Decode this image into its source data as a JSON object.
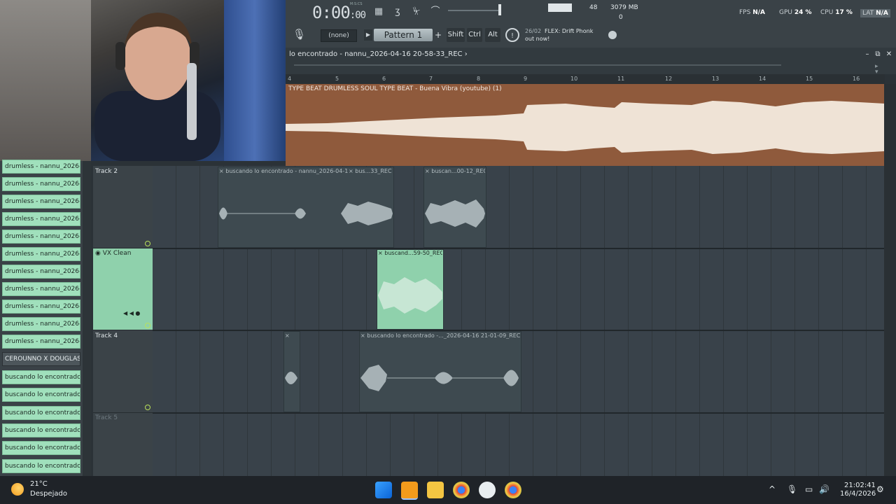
{
  "transport": {
    "time": "0:00",
    "time_frac": ":00",
    "time_sub": "M:S:CS"
  },
  "stats": {
    "cpu_graph_num": "48",
    "memory": "3079 MB",
    "polyphony": "0"
  },
  "perf": {
    "fps_label": "FPS",
    "fps_value": "N/A",
    "gpu_label": "GPU",
    "gpu_value": "24 %",
    "cpu_label": "CPU",
    "cpu_value": "17 %",
    "lat_label": "LAT",
    "lat_value": "N/A"
  },
  "toolbar2": {
    "snap": "(none)",
    "pattern": "Pattern 1",
    "shift": "Shift",
    "ctrl": "Ctrl",
    "alt": "Alt"
  },
  "news": {
    "date": "26/02",
    "title": "FLEX: Drift Phonk",
    "line2": "out now!"
  },
  "playlist": {
    "title": "lo encontrado - nannu_2026-04-16 20-58-33_REC",
    "title_arrow": "›"
  },
  "ruler": [
    "4",
    "5",
    "6",
    "7",
    "8",
    "9",
    "10",
    "11",
    "12",
    "13",
    "14",
    "15",
    "16"
  ],
  "track1": {
    "clip_title": "TYPE BEAT  DRUMLESS SOUL TYPE BEAT - Buena Vibra (youtube) (1)"
  },
  "sidebar": {
    "items": [
      "drumless - nannu_2026-...",
      "drumless - nannu_2026-...",
      "drumless - nannu_2026-...",
      "drumless - nannu_2026-...",
      "drumless - nannu_2026-...",
      "drumless - nannu_2026-...",
      "drumless - nannu_2026-...",
      "drumless - nannu_2026-...",
      "drumless - nannu_2026-...",
      "drumless - nannu_2026-...",
      "drumless - nannu_2026-...",
      "CEROUNNO X DOUGLAS...",
      "buscando lo encontrado -...",
      "buscando lo encontrado -...",
      "buscando lo encontrado -...",
      "buscando lo encontrado -...",
      "buscando lo encontrado -...",
      "buscando lo encontrado -..."
    ]
  },
  "tracks": {
    "t2": {
      "name": "Track 2"
    },
    "t3": {
      "name": "VX Clean"
    },
    "t4": {
      "name": "Track 4"
    },
    "t5": {
      "name": "Track 5"
    }
  },
  "clips": {
    "c1": "× buscando lo encontrado - nannu_2026-04-1",
    "c2": "× bus...33_REC",
    "c3": "× buscan...00-12_REC",
    "c4": "× buscand...59-50_REC",
    "c5": "×",
    "c6": "× buscando lo encontrado -..._2026-04-16 21-01-09_REC"
  },
  "taskbar": {
    "temp": "21°C",
    "weather": "Despejado",
    "time": "21:02:41",
    "date": "16/4/2026"
  },
  "colors": {
    "accent_green": "#a0e0bc",
    "clip_brown": "#8f5a3c",
    "lane_bg": "#39424a"
  }
}
